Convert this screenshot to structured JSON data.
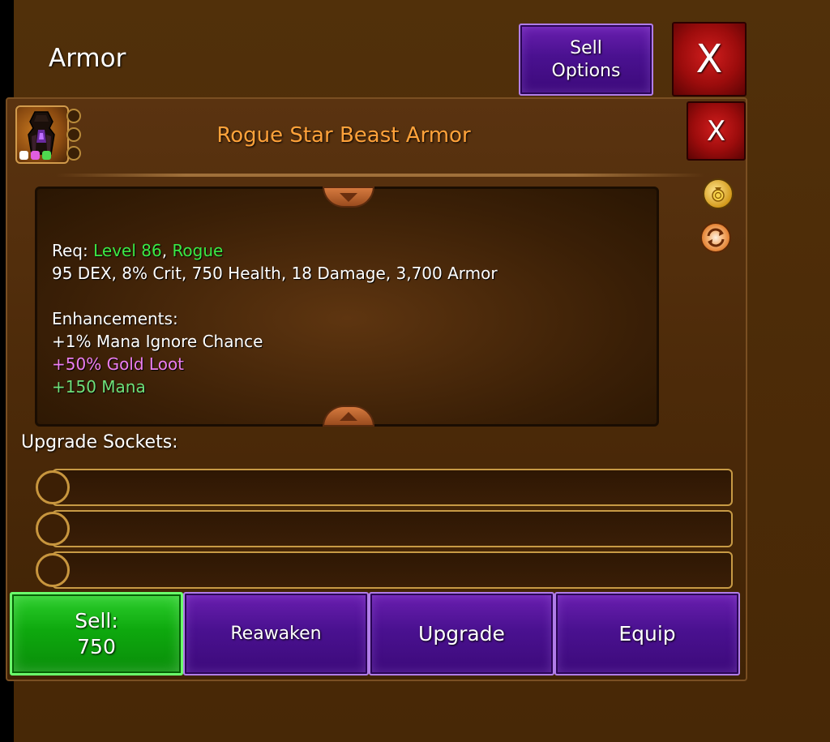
{
  "header": {
    "title": "Armor",
    "sell_options_line1": "Sell",
    "sell_options_line2": "Options",
    "close_label": "X"
  },
  "item": {
    "name": "Rogue Star Beast Armor",
    "close_label": "X",
    "rarity_colors": [
      "#ffffff",
      "#e05ee0",
      "#4fd84f"
    ]
  },
  "stats": {
    "req_prefix": "Req:",
    "req_level": "Level 86",
    "req_sep": ",",
    "req_class": "Rogue",
    "main_stats": "95 DEX, 8% Crit, 750 Health, 18 Damage, 3,700 Armor",
    "enhancements_title": "Enhancements:",
    "enhancements": [
      {
        "text": "+1% Mana Ignore Chance",
        "color": "#ffffff"
      },
      {
        "text": "+50% Gold Loot",
        "color": "#ec7ef0"
      },
      {
        "text": "+150 Mana",
        "color": "#6fe07a"
      }
    ]
  },
  "sockets": {
    "label": "Upgrade Sockets:",
    "count": 3
  },
  "actions": {
    "sell_label": "Sell:",
    "sell_price": "750",
    "reawaken": "Reawaken",
    "upgrade": "Upgrade",
    "equip": "Equip"
  },
  "icons": {
    "side": [
      "gold-bag-icon",
      "reset-icon"
    ],
    "item": "armor-item-icon"
  }
}
